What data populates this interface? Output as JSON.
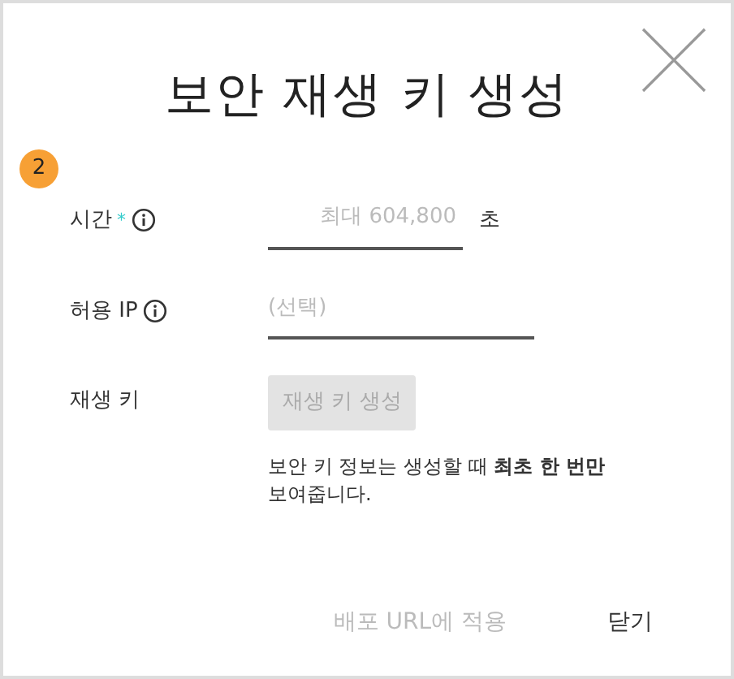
{
  "dialog": {
    "title": "보안 재생 키 생성",
    "step": "2"
  },
  "fields": [
    {
      "kind": "input",
      "label": "시간",
      "required_mark": "*",
      "info": true,
      "placeholder": "최대 604,800",
      "unit": "초"
    },
    {
      "kind": "input",
      "label": "허용 IP",
      "info": true,
      "placeholder": "(선택)"
    },
    {
      "kind": "button",
      "label": "재생 키",
      "button": {
        "text": "재생 키 생성",
        "disabled": true
      },
      "note": "보안 키 정보는 생성할 때 **최초 한 번만** 보여줍니다."
    }
  ],
  "footer": [
    {
      "text": "배포 URL에 적용",
      "disabled": true
    },
    {
      "text": "닫기",
      "disabled": false
    }
  ]
}
